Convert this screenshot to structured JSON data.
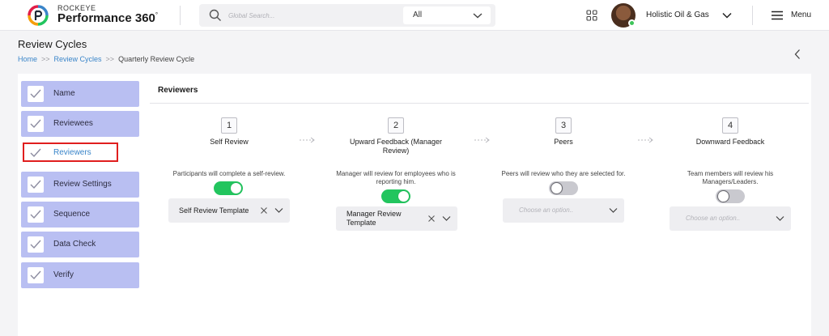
{
  "header": {
    "brand_small": "ROCKEYE",
    "brand_name": "Performance 360",
    "brand_degree": "°",
    "search_placeholder": "Global Search...",
    "search_scope": "All",
    "org_name": "Holistic Oil & Gas",
    "menu_label": "Menu"
  },
  "page": {
    "title": "Review Cycles",
    "breadcrumb": [
      "Home",
      "Review Cycles",
      "Quarterly Review Cycle"
    ],
    "breadcrumb_sep": ">>"
  },
  "sidebar": {
    "items": [
      {
        "label": "Name",
        "completed": true
      },
      {
        "label": "Reviewees",
        "completed": true
      },
      {
        "label": "Reviewers",
        "completed": false,
        "active": true
      },
      {
        "label": "Review Settings",
        "completed": true
      },
      {
        "label": "Sequence",
        "completed": true
      },
      {
        "label": "Data Check",
        "completed": true
      },
      {
        "label": "Verify",
        "completed": true
      }
    ]
  },
  "reviewers": {
    "section_title": "Reviewers",
    "steps": [
      {
        "number": "1",
        "title": "Self Review",
        "description": "Participants will complete a self-review.",
        "enabled": true,
        "template": "Self Review Template",
        "placeholder": ""
      },
      {
        "number": "2",
        "title": "Upward Feedback (Manager Review)",
        "description": "Manager will review for employees who is reporting him.",
        "enabled": true,
        "template": "Manager Review Template",
        "placeholder": ""
      },
      {
        "number": "3",
        "title": "Peers",
        "description": "Peers will review who they are selected for.",
        "enabled": false,
        "template": "",
        "placeholder": "Choose an option.."
      },
      {
        "number": "4",
        "title": "Downward Feedback",
        "description": "Team members will review his Managers/Leaders.",
        "enabled": false,
        "template": "",
        "placeholder": "Choose an option.."
      }
    ]
  },
  "colors": {
    "accent": "#3a85c9",
    "nav_item_bg": "#b9bff2",
    "toggle_on": "#22c55e",
    "toggle_off": "#c9c9cf",
    "highlight": "#e01e1e"
  }
}
